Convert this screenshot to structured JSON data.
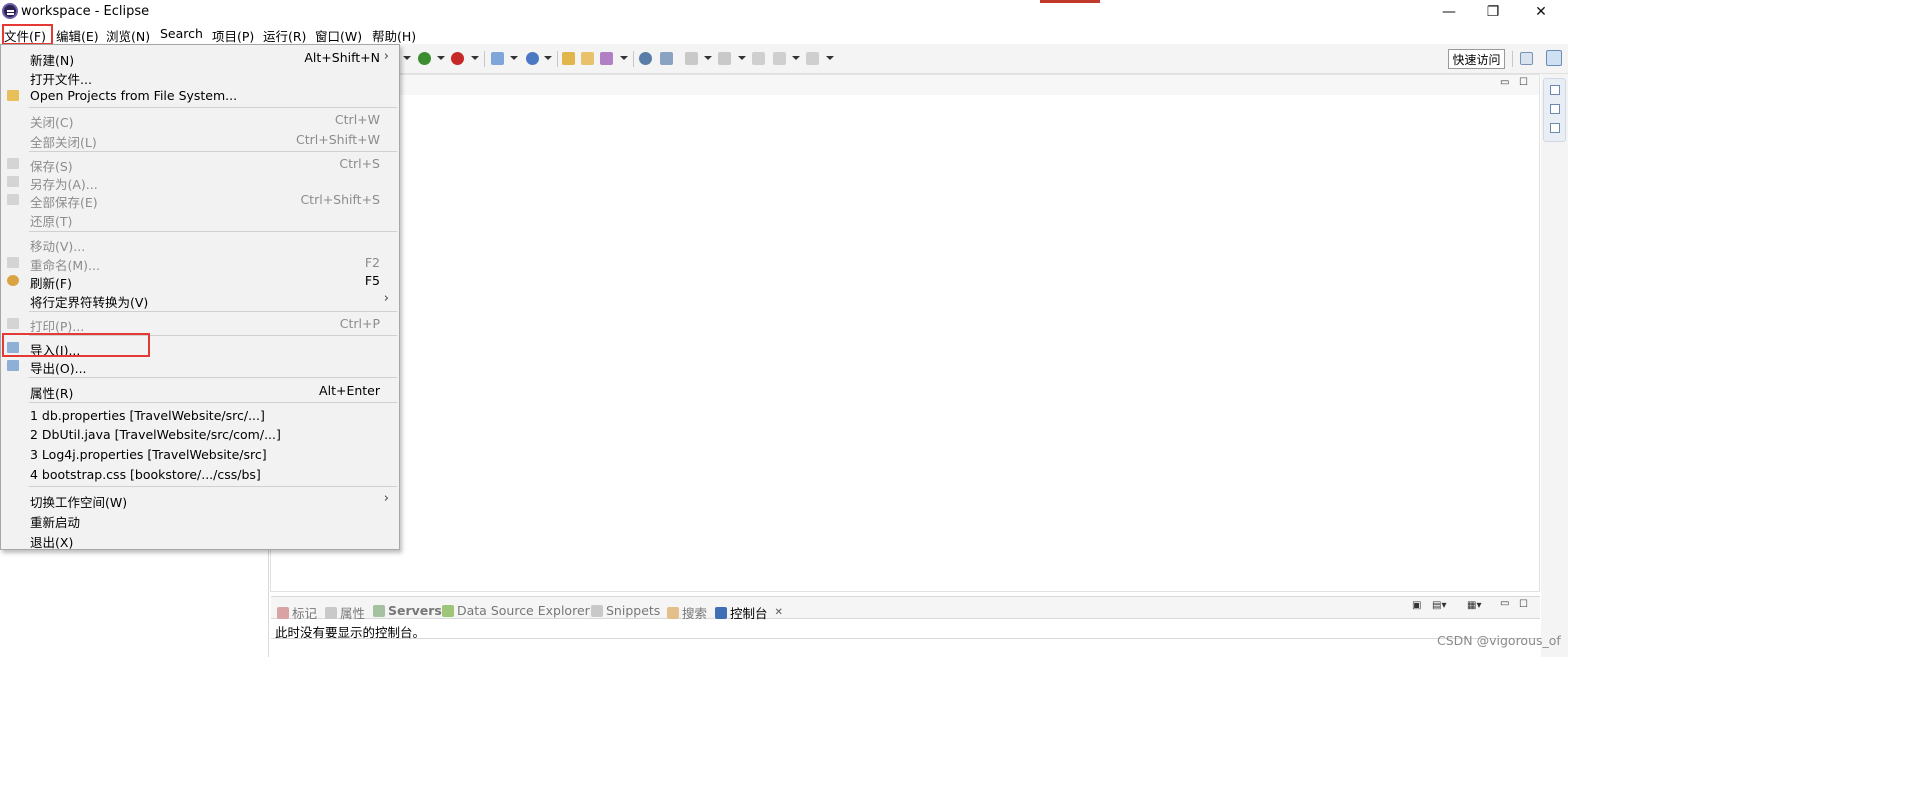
{
  "window": {
    "title": "workspace - Eclipse",
    "minimize": "—",
    "restore": "❐",
    "close": "✕"
  },
  "menubar": {
    "items": [
      "文件(F)",
      "编辑(E)",
      "浏览(N)",
      "Search",
      "项目(P)",
      "运行(R)",
      "窗口(W)",
      "帮助(H)"
    ]
  },
  "toolbar": {
    "quick_access": "快速访问"
  },
  "file_menu": {
    "new": {
      "label": "新建(N)",
      "shortcut": "Alt+Shift+N"
    },
    "open_file": {
      "label": "打开文件..."
    },
    "open_projects": {
      "label": "Open Projects from File System..."
    },
    "close": {
      "label": "关闭(C)",
      "shortcut": "Ctrl+W"
    },
    "close_all": {
      "label": "全部关闭(L)",
      "shortcut": "Ctrl+Shift+W"
    },
    "save": {
      "label": "保存(S)",
      "shortcut": "Ctrl+S"
    },
    "save_as": {
      "label": "另存为(A)..."
    },
    "save_all": {
      "label": "全部保存(E)",
      "shortcut": "Ctrl+Shift+S"
    },
    "revert": {
      "label": "还原(T)"
    },
    "move": {
      "label": "移动(V)..."
    },
    "rename": {
      "label": "重命名(M)...",
      "shortcut": "F2"
    },
    "refresh": {
      "label": "刷新(F)",
      "shortcut": "F5"
    },
    "convert_line_delimiters": {
      "label": "将行定界符转换为(V)"
    },
    "print": {
      "label": "打印(P)...",
      "shortcut": "Ctrl+P"
    },
    "import": {
      "label": "导入(I)..."
    },
    "export": {
      "label": "导出(O)..."
    },
    "properties": {
      "label": "属性(R)",
      "shortcut": "Alt+Enter"
    },
    "recent_files": [
      "1 db.properties  [TravelWebsite/src/...]",
      "2 DbUtil.java  [TravelWebsite/src/com/...]",
      "3 Log4j.properties  [TravelWebsite/src]",
      "4 bootstrap.css  [bookstore/.../css/bs]"
    ],
    "switch_workspace": {
      "label": "切换工作空间(W)"
    },
    "restart": {
      "label": "重新启动"
    },
    "exit": {
      "label": "退出(X)"
    },
    "submenu_arrow": "›"
  },
  "bottom_panel": {
    "tabs": [
      {
        "label": "标记",
        "active": false
      },
      {
        "label": "属性",
        "active": false
      },
      {
        "label": "Servers",
        "active": false
      },
      {
        "label": "Data Source Explorer",
        "active": false
      },
      {
        "label": "Snippets",
        "active": false
      },
      {
        "label": "搜索",
        "active": false
      },
      {
        "label": "控制台",
        "active": true
      }
    ],
    "tab_close": "✕",
    "console_message": "此时没有要显示的控制台。"
  },
  "watermark": "CSDN @vigorous_of",
  "colors": {
    "highlight_box": "#e53935",
    "menu_bg": "#f2f2f2",
    "disabled_text": "#8c8c8c"
  }
}
